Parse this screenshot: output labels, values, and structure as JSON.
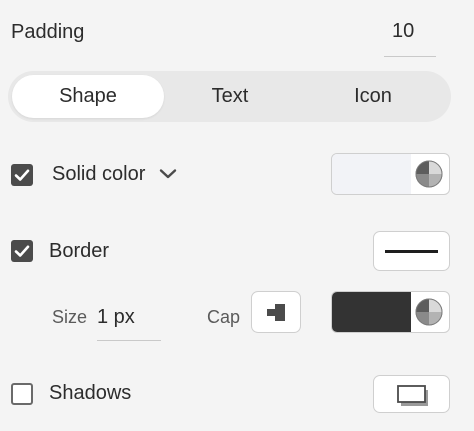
{
  "padding": {
    "label": "Padding",
    "value": "10"
  },
  "tabs": [
    {
      "label": "Shape",
      "active": true
    },
    {
      "label": "Text",
      "active": false
    },
    {
      "label": "Icon",
      "active": false
    }
  ],
  "fill": {
    "checked": true,
    "mode_label": "Solid color",
    "color": "#f2f3f7",
    "icon": "chevron-down-icon"
  },
  "border": {
    "checked": true,
    "label": "Border",
    "line_style_icon": "solid-line-icon",
    "size_label": "Size",
    "size_value": "1 px",
    "cap_label": "Cap",
    "cap_icon": "line-cap-icon",
    "color": "#333333"
  },
  "shadows": {
    "checked": false,
    "label": "Shadows",
    "icon": "shadow-preview-icon"
  },
  "colors": {
    "background": "#f4f4f4",
    "checkbox": "#4b4b4b",
    "border_color": "#333333",
    "fill_color": "#f2f3f7"
  }
}
